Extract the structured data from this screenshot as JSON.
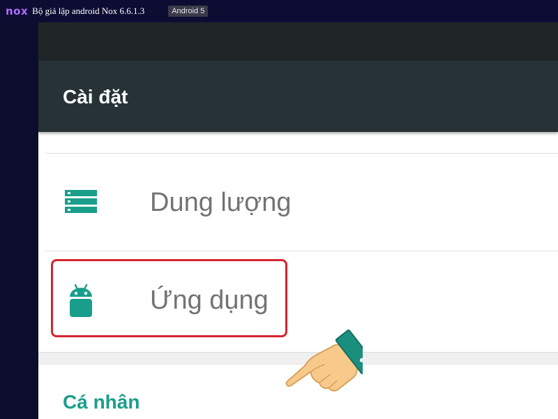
{
  "window": {
    "logo_text": "nox",
    "title": "Bộ giả lập android Nox 6.6.1.3",
    "version_badge": "Android 5"
  },
  "settings": {
    "title": "Cài đặt",
    "items": [
      {
        "label": "Dung lượng",
        "icon": "storage-icon"
      },
      {
        "label": "Ứng dụng",
        "icon": "android-icon"
      }
    ],
    "section_header": "Cá nhân"
  },
  "colors": {
    "accent": "#1a9e8c",
    "toolbar": "#263236",
    "statusbar": "#202628",
    "highlight": "#d4242f",
    "logo": "#b06cff"
  }
}
